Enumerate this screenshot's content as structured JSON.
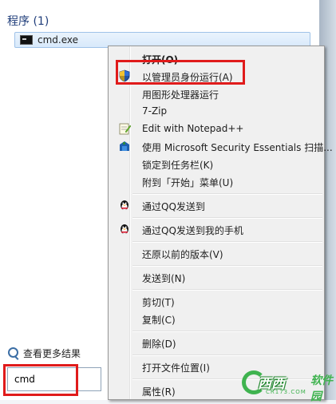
{
  "start_menu": {
    "section_header": "程序 (1)",
    "result_item_label": "cmd.exe",
    "see_more_label": "查看更多结果",
    "search_value": "cmd"
  },
  "context_menu": {
    "items": [
      {
        "label": "打开(O)",
        "icon": "none",
        "bold": true
      },
      {
        "label": "以管理员身份运行(A)",
        "icon": "uac-shield-icon"
      },
      {
        "label": "用图形处理器运行",
        "icon": "none"
      },
      {
        "label": "7-Zip",
        "icon": "none"
      },
      {
        "label": "Edit with Notepad++",
        "icon": "notepad-plus-plus-icon"
      },
      {
        "label": "使用 Microsoft Security Essentials 扫描...",
        "icon": "security-essentials-icon"
      },
      {
        "label": "锁定到任务栏(K)",
        "icon": "none"
      },
      {
        "label": "附到「开始」菜单(U)",
        "icon": "none"
      },
      {
        "label": "通过QQ发送到",
        "icon": "qq-penguin-icon"
      },
      {
        "label": "通过QQ发送到我的手机",
        "icon": "qq-penguin-icon"
      },
      {
        "label": "还原以前的版本(V)",
        "icon": "none"
      },
      {
        "label": "发送到(N)",
        "icon": "none"
      },
      {
        "label": "剪切(T)",
        "icon": "none"
      },
      {
        "label": "复制(C)",
        "icon": "none"
      },
      {
        "label": "删除(D)",
        "icon": "none"
      },
      {
        "label": "打开文件位置(I)",
        "icon": "none"
      },
      {
        "label": "属性(R)",
        "icon": "none"
      }
    ]
  },
  "watermark": {
    "brand_text": "西西",
    "brand_suffix": "软件园",
    "domain": "CR173.COM"
  },
  "colors": {
    "highlight_red": "#e01b1b",
    "selection_blue": "#d8e9fb",
    "brand_green": "#3fb34f"
  }
}
